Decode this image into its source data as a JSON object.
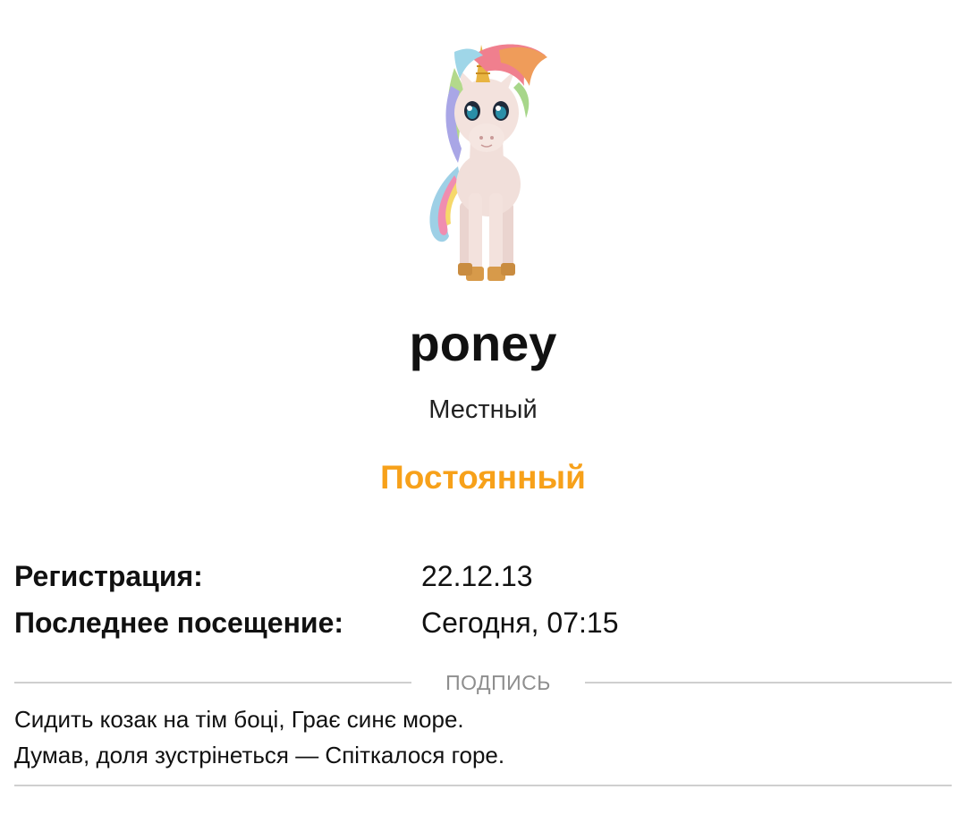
{
  "profile": {
    "avatar_icon": "pony-avatar-icon",
    "username": "poney",
    "title": "Местный",
    "rank": "Постоянный",
    "rank_color": "#f7a11a"
  },
  "info": {
    "registration_label": "Регистрация:",
    "registration_value": "22.12.13",
    "last_visit_label": "Последнее посещение:",
    "last_visit_value": "Сегодня, 07:15"
  },
  "signature": {
    "heading": "ПОДПИСЬ",
    "lines": [
      "Сидить козак на тім боці, Грає синє море.",
      "Думав, доля зустрінеться — Спіткалося горе."
    ]
  }
}
